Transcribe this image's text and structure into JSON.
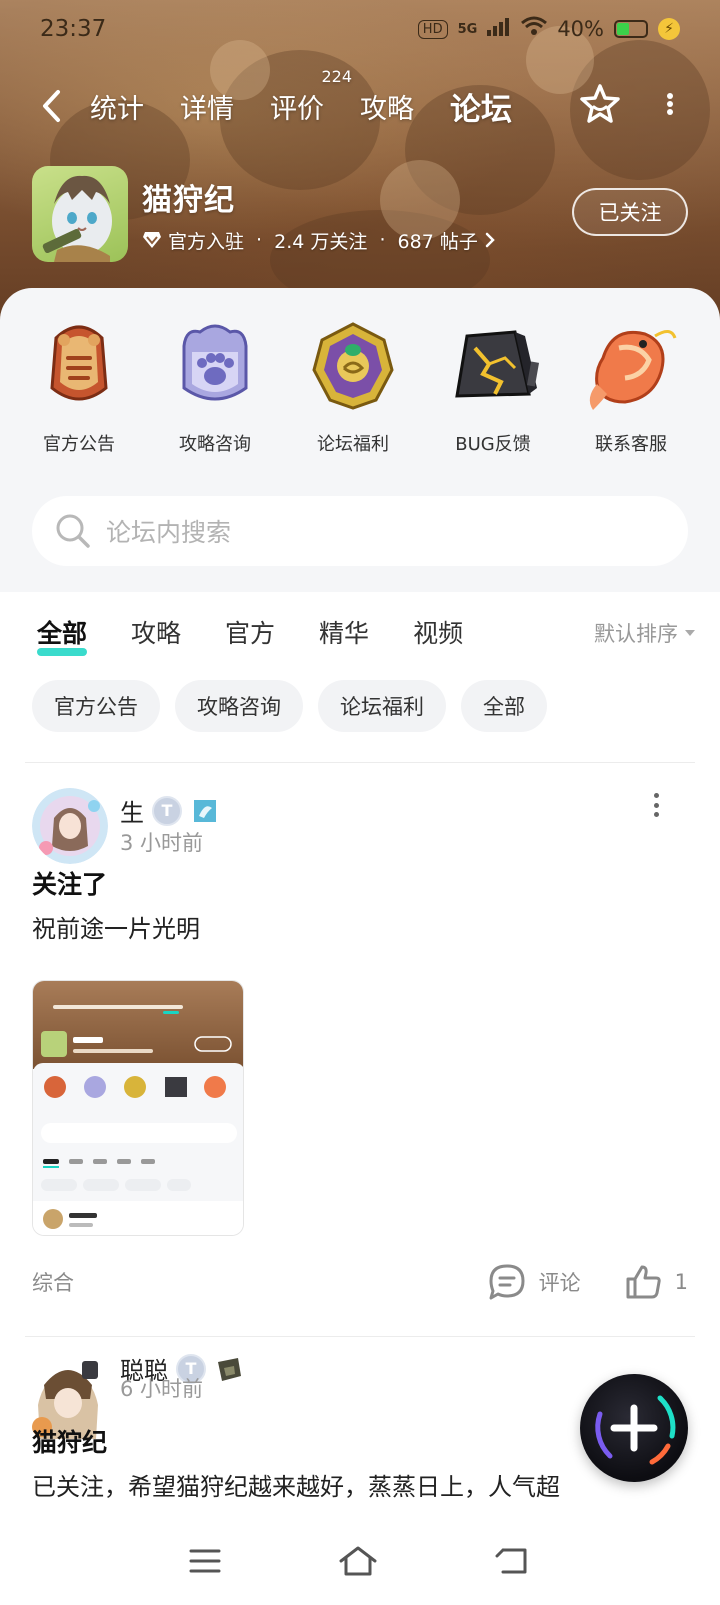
{
  "status_bar": {
    "time": "23:37",
    "hd_label": "HD",
    "signal_label": "5G",
    "battery": "40%"
  },
  "nav": {
    "tabs": [
      {
        "label": "统计"
      },
      {
        "label": "详情"
      },
      {
        "label": "评价",
        "badge": "224"
      },
      {
        "label": "攻略"
      },
      {
        "label": "论坛",
        "active": true
      }
    ]
  },
  "game": {
    "name": "猫狩纪",
    "official": "官方入驻",
    "followers": "2.4 万关注",
    "posts": "687 帖子",
    "follow_label": "已关注"
  },
  "categories": [
    {
      "label": "官方公告",
      "icon": "announcement-icon"
    },
    {
      "label": "攻略咨询",
      "icon": "paw-icon"
    },
    {
      "label": "论坛福利",
      "icon": "emblem-icon"
    },
    {
      "label": "BUG反馈",
      "icon": "cracked-stone-icon"
    },
    {
      "label": "联系客服",
      "icon": "koi-fish-icon"
    }
  ],
  "search": {
    "placeholder": "论坛内搜索"
  },
  "filter_tabs": [
    {
      "label": "全部",
      "active": true
    },
    {
      "label": "攻略"
    },
    {
      "label": "官方"
    },
    {
      "label": "精华"
    },
    {
      "label": "视频"
    }
  ],
  "sort_label": "默认排序",
  "chips": [
    "官方公告",
    "攻略咨询",
    "论坛福利",
    "全部"
  ],
  "posts": [
    {
      "author": "生",
      "level": "T",
      "time": "3 小时前",
      "title": "关注了",
      "body": "祝前途一片光明",
      "tag": "综合",
      "comment_label": "评论",
      "likes": "1"
    },
    {
      "author": "聪聪",
      "level": "T",
      "time": "6 小时前",
      "title": "猫狩纪",
      "body": "已关注，希望猫狩纪越来越好，蒸蒸日上，人气超"
    }
  ],
  "colors": {
    "accent": "#18d5c3",
    "header_brown": "#8a5a38",
    "panel_bg": "#f5f6f8"
  }
}
